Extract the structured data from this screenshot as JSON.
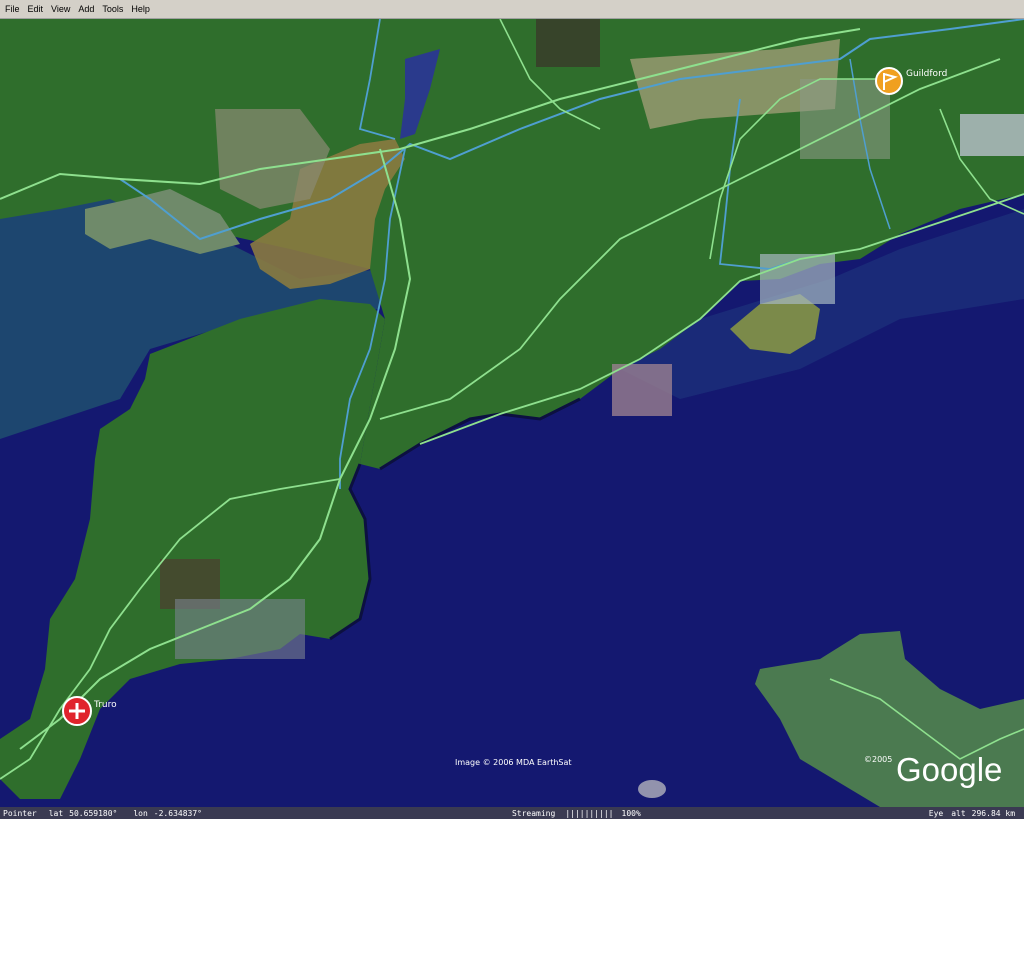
{
  "menu": {
    "file": "File",
    "edit": "Edit",
    "view": "View",
    "add": "Add",
    "tools": "Tools",
    "help": "Help"
  },
  "places": {
    "guildford": "Guildford",
    "truro": "Truro"
  },
  "map": {
    "imagery_credit": "Image © 2006 MDA EarthSat",
    "copyright_year": "©2005",
    "logo_text": "Google"
  },
  "status": {
    "pointer_label": "Pointer",
    "lat_label": "lat",
    "lat_value": "50.659180°",
    "lon_label": "lon",
    "lon_value": "-2.634837°",
    "streaming_label": "Streaming",
    "streaming_bars": "||||||||||",
    "streaming_percent": "100%",
    "eye_label": "Eye",
    "alt_label": "alt",
    "alt_value": "296.84 km"
  },
  "colors": {
    "sea": "#141870",
    "land": "#2f6e2c",
    "road": "#8ee08e",
    "river": "#4f9fd0",
    "marker_red": "#e0242c",
    "marker_orange": "#f0a020"
  }
}
